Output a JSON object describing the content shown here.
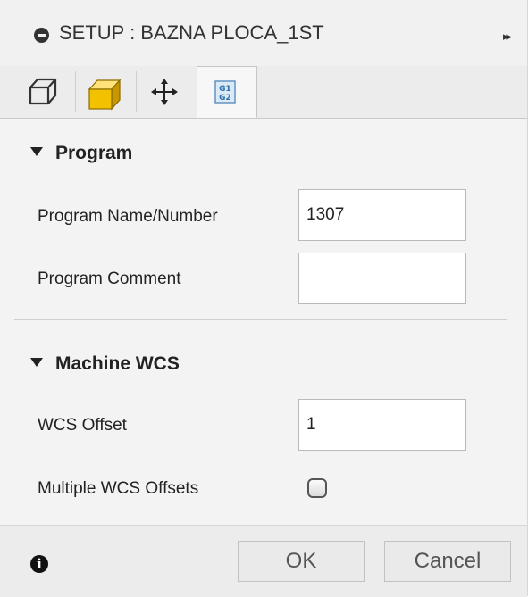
{
  "titlebar": {
    "title": "SETUP : BAZNA PLOCA_1ST",
    "collapse_icon": "minus-circle-icon",
    "expand_icon": "double-chevron-right-icon",
    "expand_glyph": "▸▸"
  },
  "tabs": [
    {
      "name": "setup",
      "icon": "wireframe-box-icon"
    },
    {
      "name": "stock",
      "icon": "solid-box-icon",
      "color": "#f2c200"
    },
    {
      "name": "post-process",
      "icon": "move-arrows-icon"
    },
    {
      "name": "program",
      "icon": "g-code-icon",
      "glyph_top": "G1",
      "glyph_bottom": "G2",
      "active": true
    }
  ],
  "program": {
    "header": "Program",
    "name_label": "Program Name/Number",
    "name_value": "1307",
    "comment_label": "Program Comment",
    "comment_value": ""
  },
  "machine_wcs": {
    "header": "Machine WCS",
    "offset_label": "WCS Offset",
    "offset_value": "1",
    "multiple_label": "Multiple WCS Offsets",
    "multiple_checked": false
  },
  "footer": {
    "info_glyph": "i",
    "ok_label": "OK",
    "cancel_label": "Cancel"
  }
}
